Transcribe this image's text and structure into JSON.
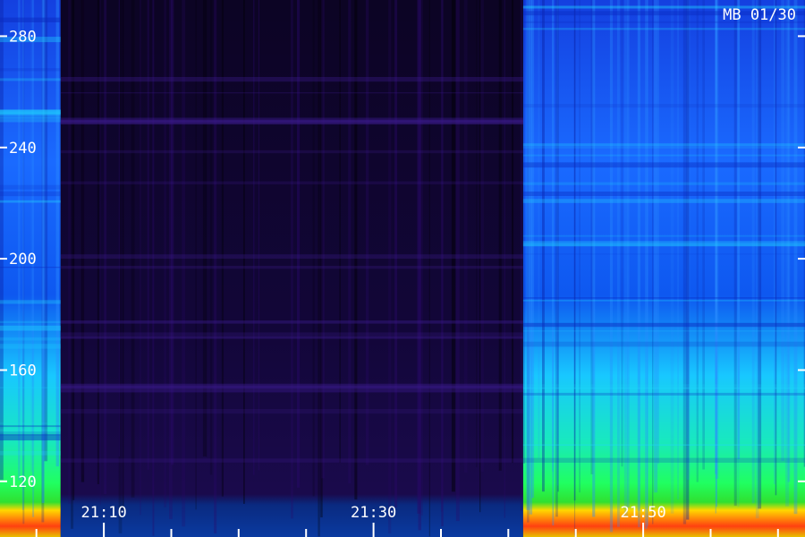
{
  "chart_data": {
    "type": "heatmap",
    "title": "MB 01/30",
    "xlabel": "",
    "ylabel": "",
    "x_tick_labels": [
      "21:10",
      "21:30",
      "21:50"
    ],
    "y_tick_labels": [
      "280",
      "240",
      "200",
      "160",
      "120"
    ],
    "y_ticks": [
      280,
      240,
      200,
      160,
      120
    ],
    "ylim": [
      100,
      293
    ],
    "x_minutes_range": [
      21.0,
      21.0
    ],
    "x_ticks_minutes": [
      70,
      90,
      110
    ],
    "x_range_minutes": [
      62.3,
      122.0
    ],
    "segments": [
      {
        "label": "",
        "x_start_minutes": 62.3,
        "x_end_minutes": 66.8,
        "level": "high"
      },
      {
        "label": "",
        "x_start_minutes": 66.8,
        "x_end_minutes": 101.1,
        "level": "low"
      },
      {
        "label": "",
        "x_start_minutes": 101.1,
        "x_end_minutes": 122.0,
        "level": "high"
      }
    ],
    "grid": false,
    "colormap": [
      "#000000",
      "#2a0a6a",
      "#0a2ad8",
      "#1a6aff",
      "#18d8ff",
      "#20ff80",
      "#ffd800",
      "#ff2a00"
    ]
  }
}
